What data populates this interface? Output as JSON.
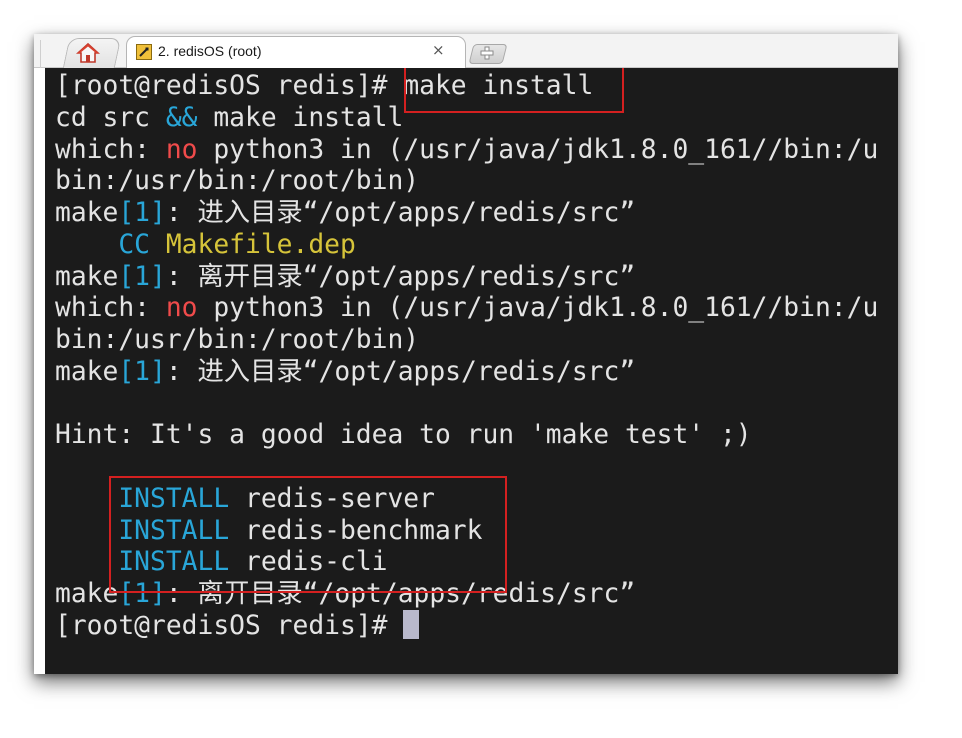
{
  "tab": {
    "title": "2. redisOS (root)",
    "close_glyph": "×",
    "home_icon": "home-icon",
    "session_icon": "terminal-session-icon",
    "new_tab_icon": "new-tab-icon"
  },
  "colors": {
    "terminal_bg": "#1b1b1b",
    "text": "#e4e4e4",
    "blue": "#29a6d8",
    "red": "#f04b4b",
    "yellow": "#d6c43a",
    "highlight": "#d42020",
    "cursor": "#b9b9cc"
  },
  "terminal": {
    "lines": [
      {
        "segments": [
          {
            "text": "[root@redisOS redis]# ",
            "color": "white"
          },
          {
            "text": "make install",
            "color": "white"
          }
        ]
      },
      {
        "segments": [
          {
            "text": "cd src ",
            "color": "white"
          },
          {
            "text": "&&",
            "color": "blue"
          },
          {
            "text": " make install",
            "color": "white"
          }
        ]
      },
      {
        "segments": [
          {
            "text": "which: ",
            "color": "white"
          },
          {
            "text": "no",
            "color": "red"
          },
          {
            "text": " python3 in (/usr/java/jdk1.8.0_161//bin:/u",
            "color": "white"
          }
        ]
      },
      {
        "segments": [
          {
            "text": "bin:/usr/bin:/root/bin)",
            "color": "white"
          }
        ]
      },
      {
        "segments": [
          {
            "text": "make",
            "color": "white"
          },
          {
            "text": "[1]",
            "color": "blue"
          },
          {
            "text": ": 进入目录“/opt/apps/redis/src”",
            "color": "white"
          }
        ]
      },
      {
        "segments": [
          {
            "text": "    CC ",
            "color": "blue"
          },
          {
            "text": "Makefile.dep",
            "color": "yellow"
          }
        ]
      },
      {
        "segments": [
          {
            "text": "make",
            "color": "white"
          },
          {
            "text": "[1]",
            "color": "blue"
          },
          {
            "text": ": 离开目录“/opt/apps/redis/src”",
            "color": "white"
          }
        ]
      },
      {
        "segments": [
          {
            "text": "which: ",
            "color": "white"
          },
          {
            "text": "no",
            "color": "red"
          },
          {
            "text": " python3 in (/usr/java/jdk1.8.0_161//bin:/u",
            "color": "white"
          }
        ]
      },
      {
        "segments": [
          {
            "text": "bin:/usr/bin:/root/bin)",
            "color": "white"
          }
        ]
      },
      {
        "segments": [
          {
            "text": "make",
            "color": "white"
          },
          {
            "text": "[1]",
            "color": "blue"
          },
          {
            "text": ": 进入目录“/opt/apps/redis/src”",
            "color": "white"
          }
        ]
      },
      {
        "segments": []
      },
      {
        "segments": [
          {
            "text": "Hint: It's a good idea to run 'make test' ;)",
            "color": "white"
          }
        ]
      },
      {
        "segments": []
      },
      {
        "segments": [
          {
            "text": "    INSTALL",
            "color": "blue"
          },
          {
            "text": " redis-server",
            "color": "white"
          }
        ]
      },
      {
        "segments": [
          {
            "text": "    INSTALL",
            "color": "blue"
          },
          {
            "text": " redis-benchmark",
            "color": "white"
          }
        ]
      },
      {
        "segments": [
          {
            "text": "    INSTALL",
            "color": "blue"
          },
          {
            "text": " redis-cli",
            "color": "white"
          }
        ]
      },
      {
        "segments": [
          {
            "text": "make",
            "color": "white"
          },
          {
            "text": "[1]",
            "color": "blue"
          },
          {
            "text": ": 离开目录“/opt/apps/redis/src”",
            "color": "white"
          }
        ]
      },
      {
        "segments": [
          {
            "text": "[root@redisOS redis]# ",
            "color": "white"
          }
        ],
        "cursor": true
      }
    ]
  }
}
